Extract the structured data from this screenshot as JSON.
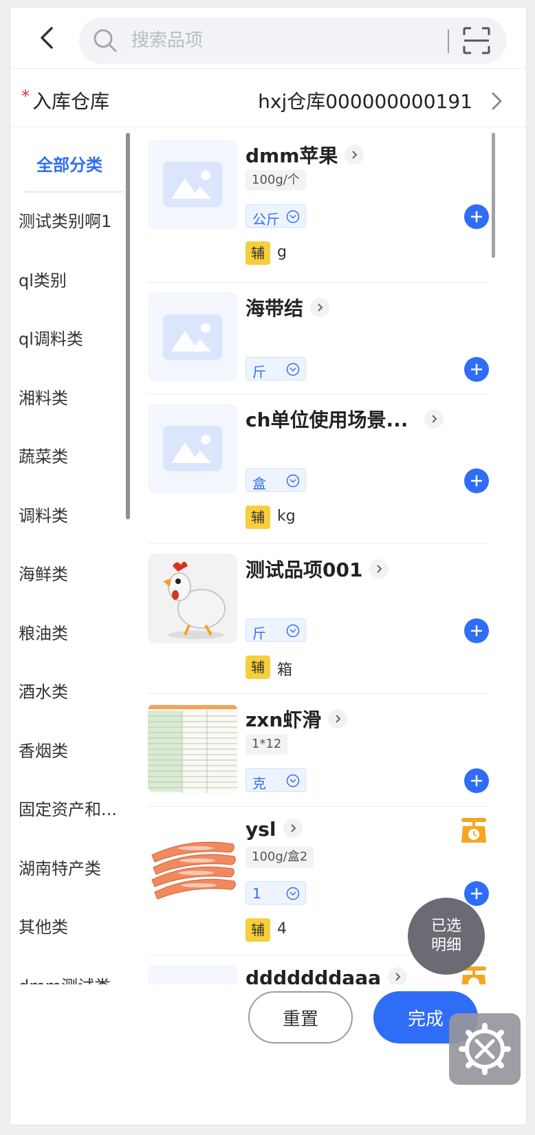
{
  "header": {
    "search_placeholder": "搜索品项"
  },
  "warehouse": {
    "required_mark": "*",
    "label": "入库仓库",
    "value": "hxj仓库000000000191"
  },
  "sidebar": {
    "active": "全部分类",
    "items": [
      {
        "label": "测试类别啊1"
      },
      {
        "label": "ql类别"
      },
      {
        "label": "ql调料类"
      },
      {
        "label": "湘料类"
      },
      {
        "label": "蔬菜类"
      },
      {
        "label": "调料类"
      },
      {
        "label": "海鲜类"
      },
      {
        "label": "粮油类"
      },
      {
        "label": "酒水类"
      },
      {
        "label": "香烟类"
      },
      {
        "label": "固定资产和..."
      },
      {
        "label": "湖南特产类"
      },
      {
        "label": "其他类"
      },
      {
        "label": "dmm测试类"
      }
    ]
  },
  "products": [
    {
      "name": "dmm苹果",
      "spec": "100g/个",
      "unit": "公斤",
      "aux_badge": "辅",
      "aux_unit": "g"
    },
    {
      "name": "海带结",
      "unit": "斤"
    },
    {
      "name": "ch单位使用场景...",
      "unit": "盒",
      "aux_badge": "辅",
      "aux_unit": "kg"
    },
    {
      "name": "测试品项001",
      "unit": "斤",
      "aux_badge": "辅",
      "aux_unit": "箱"
    },
    {
      "name": "zxn虾滑",
      "spec": "1*12",
      "unit": "克"
    },
    {
      "name": "ysl",
      "spec": "100g/盒2",
      "unit": "1",
      "aux_badge": "辅",
      "aux_unit": "4"
    },
    {
      "name": "dddddddaaa"
    }
  ],
  "floating": {
    "selected_line1": "已选",
    "selected_line2": "明细"
  },
  "footer": {
    "reset_label": "重置",
    "done_label": "完成"
  },
  "colors": {
    "accent": "#2f6df6",
    "aux_badge": "#f7ce3c",
    "scale_icon": "#f5a623",
    "required": "#e0323a"
  }
}
